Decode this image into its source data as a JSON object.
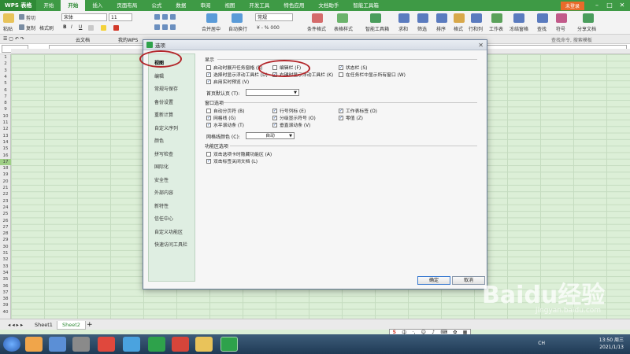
{
  "app": {
    "name": "WPS 表格",
    "tabs": [
      "开始",
      "开始",
      "插入",
      "页面布局",
      "公式",
      "数据",
      "审阅",
      "视图",
      "开发工具",
      "特色应用",
      "文档助手",
      "智能工具箱"
    ],
    "active_tab_index": 1,
    "login_label": "未登录"
  },
  "ribbon": {
    "paste": "粘贴",
    "cut": "剪切",
    "copy": "复制",
    "format_painter": "格式刷",
    "font": "宋体",
    "size": "11",
    "number_format": "常规",
    "merge": "合并居中",
    "wrap": "自动换行",
    "cond_format": "条件格式",
    "table_style": "表格样式",
    "smart_toolbox": "智能工具箱",
    "sum": "求和",
    "filter": "筛选",
    "sort": "排序",
    "format": "格式",
    "rowcol": "行和列",
    "worksheet": "工作表",
    "freeze": "冻结窗格",
    "find": "查找",
    "symbol": "符号",
    "share": "分享文档",
    "search_placeholder": "查找命令, 搜索模板"
  },
  "docrow": {
    "cloud": "云文档",
    "mywps": "我的WPS"
  },
  "grid": {
    "rows": [
      "1",
      "2",
      "3",
      "4",
      "5",
      "6",
      "7",
      "8",
      "9",
      "10",
      "11",
      "12",
      "13",
      "14",
      "15",
      "16",
      "17",
      "18",
      "19",
      "20",
      "21",
      "22",
      "23",
      "24",
      "25",
      "26",
      "27",
      "28",
      "29",
      "30",
      "31",
      "32",
      "33",
      "34",
      "35",
      "36",
      "37",
      "38",
      "39",
      "40"
    ],
    "highlight_row": "17"
  },
  "sheets": {
    "tabs": [
      "Sheet1",
      "Sheet2"
    ],
    "active": "Sheet2",
    "add": "+"
  },
  "dialog": {
    "title": "选项",
    "sidebar": [
      "视图",
      "编辑",
      "常规与保存",
      "备份设置",
      "重新计算",
      "自定义序列",
      "颜色",
      "拼写检查",
      "国际化",
      "安全性",
      "外部内容",
      "新特性",
      "信任中心",
      "自定义功能区",
      "快速访问工具栏"
    ],
    "active_index": 0,
    "section_display": "显示",
    "display_options": [
      {
        "label": "启动时展开任务窗格 (R)",
        "checked": false
      },
      {
        "label": "编辑栏 (F)",
        "checked": false
      },
      {
        "label": "状态栏 (S)",
        "checked": true
      },
      {
        "label": "选择时显示浮动工具栏 (D)",
        "checked": true
      },
      {
        "label": "右键时显示浮动工具栏 (K)",
        "checked": true
      },
      {
        "label": "在任务栏中显示所有窗口 (W)",
        "checked": false
      },
      {
        "label": "启用实时预览 (V)",
        "checked": true
      }
    ],
    "home_label": "首页默认页 (T):",
    "home_value": "",
    "section_window": "窗口选项",
    "window_options": [
      {
        "label": "自动分页符 (B)",
        "checked": false
      },
      {
        "label": "行号列标 (E)",
        "checked": true
      },
      {
        "label": "工作表标签 (O)",
        "checked": true
      },
      {
        "label": "网格线 (G)",
        "checked": true
      },
      {
        "label": "分级显示符号 (O)",
        "checked": true
      },
      {
        "label": "零值 (Z)",
        "checked": true
      },
      {
        "label": "水平滚动条 (T)",
        "checked": true
      },
      {
        "label": "垂直滚动条 (V)",
        "checked": true
      }
    ],
    "gridcolor_label": "网格线颜色 (C):",
    "gridcolor_value": "自动",
    "section_ribbon": "功能区选项",
    "ribbon_options": [
      {
        "label": "双击选项卡时隐藏功能区 (A)",
        "checked": false
      },
      {
        "label": "双击标签关闭文档 (L)",
        "checked": true
      }
    ],
    "ok": "确定",
    "cancel": "取消"
  },
  "taskbar": {
    "ime_lang": "CH",
    "time": "13:50 周三",
    "date": "2021/1/13"
  },
  "ime": {
    "label": "中"
  },
  "watermark": {
    "text": "Baidu经验",
    "site": "jingyan.baidu.com"
  },
  "colors": {
    "accent": "#3e9a45",
    "annotation": "#b3262a",
    "grid_bg": "#dcefd7"
  }
}
